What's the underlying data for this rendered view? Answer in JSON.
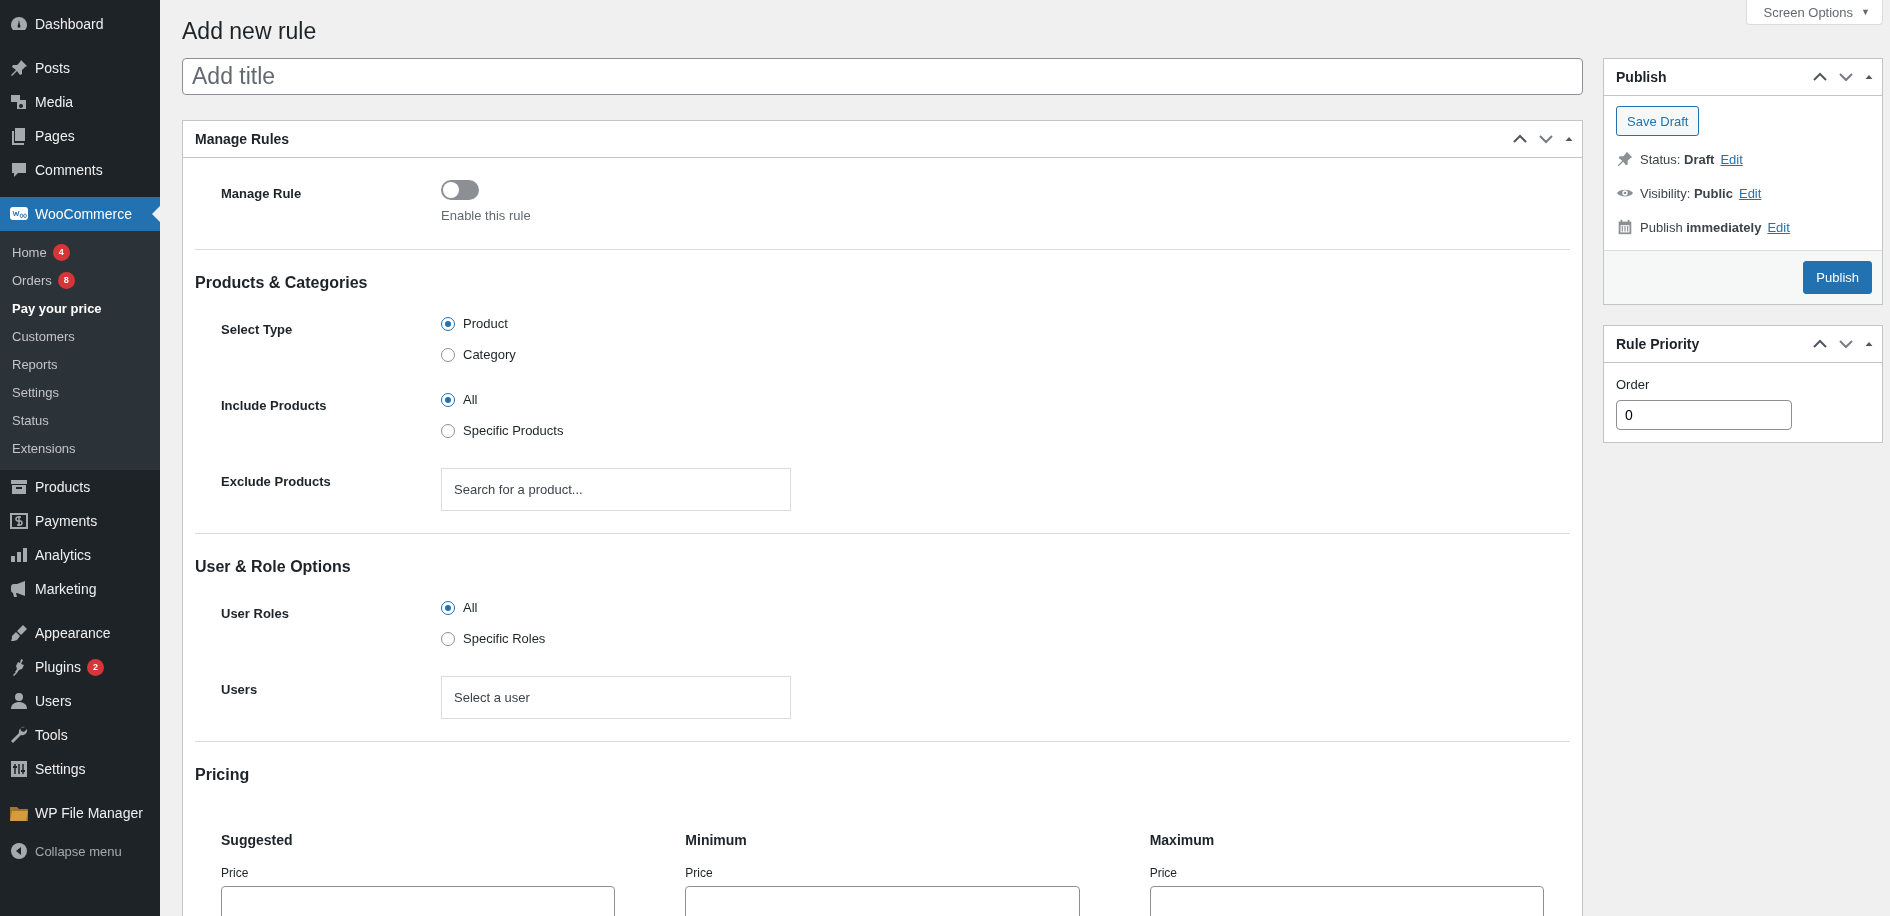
{
  "sidebar": {
    "items": [
      {
        "label": "Dashboard",
        "selected": false
      },
      {
        "label": "Posts",
        "selected": false
      },
      {
        "label": "Media",
        "selected": false
      },
      {
        "label": "Pages",
        "selected": false
      },
      {
        "label": "Comments",
        "selected": false
      },
      {
        "label": "WooCommerce",
        "selected": true,
        "children": [
          {
            "label": "Home",
            "badge": "4",
            "selected": false
          },
          {
            "label": "Orders",
            "badge": "8",
            "selected": false
          },
          {
            "label": "Pay your price",
            "selected": true
          },
          {
            "label": "Customers",
            "selected": false
          },
          {
            "label": "Reports",
            "selected": false
          },
          {
            "label": "Settings",
            "selected": false
          },
          {
            "label": "Status",
            "selected": false
          },
          {
            "label": "Extensions",
            "selected": false
          }
        ]
      },
      {
        "label": "Products",
        "selected": false
      },
      {
        "label": "Payments",
        "selected": false
      },
      {
        "label": "Analytics",
        "selected": false
      },
      {
        "label": "Marketing",
        "selected": false
      },
      {
        "label": "Appearance",
        "selected": false
      },
      {
        "label": "Plugins",
        "badge": "2",
        "selected": false
      },
      {
        "label": "Users",
        "selected": false
      },
      {
        "label": "Tools",
        "selected": false
      },
      {
        "label": "Settings",
        "selected": false
      },
      {
        "label": "WP File Manager",
        "selected": false
      }
    ],
    "collapse": "Collapse menu"
  },
  "screen_options": {
    "label": "Screen Options",
    "symbol": "▼"
  },
  "page_title": "Add new rule",
  "title_field": {
    "placeholder": "Add title"
  },
  "manage_rules": {
    "title": "Manage Rules",
    "sections": [
      {
        "fields": [
          {
            "kind": "toggle",
            "label": "Manage Rule",
            "on": false,
            "description": "Enable this rule"
          }
        ]
      },
      {
        "heading": "Products & Categories",
        "fields": [
          {
            "kind": "radio",
            "label": "Select Type",
            "options": [
              {
                "label": "Product",
                "selected": true
              },
              {
                "label": "Category",
                "selected": false
              }
            ]
          },
          {
            "kind": "radio",
            "label": "Include Products",
            "options": [
              {
                "label": "All",
                "selected": true
              },
              {
                "label": "Specific Products",
                "selected": false
              }
            ]
          },
          {
            "kind": "search",
            "label": "Exclude Products",
            "placeholder": "Search for a product..."
          }
        ]
      },
      {
        "heading": "User & Role Options",
        "fields": [
          {
            "kind": "radio",
            "label": "User Roles",
            "options": [
              {
                "label": "All",
                "selected": true
              },
              {
                "label": "Specific Roles",
                "selected": false
              }
            ]
          },
          {
            "kind": "search",
            "label": "Users",
            "placeholder": "Select a user"
          }
        ]
      },
      {
        "heading": "Pricing",
        "columns": [
          {
            "heading": "Suggested",
            "field_label": "Price"
          },
          {
            "heading": "Minimum",
            "field_label": "Price"
          },
          {
            "heading": "Maximum",
            "field_label": "Price"
          }
        ]
      }
    ]
  },
  "publish": {
    "title": "Publish",
    "save_draft": "Save Draft",
    "rows": [
      {
        "label": "Status:",
        "value": "Draft",
        "link": "Edit"
      },
      {
        "label": "Visibility:",
        "value": "Public",
        "link": "Edit"
      },
      {
        "label": "Publish",
        "value": "immediately",
        "link": "Edit"
      }
    ],
    "button": "Publish"
  },
  "rule_priority": {
    "title": "Rule Priority",
    "label": "Order",
    "value": "0"
  }
}
